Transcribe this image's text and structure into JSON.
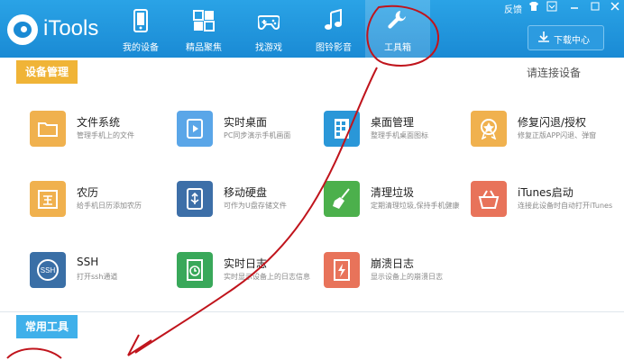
{
  "app": {
    "title": "iTools"
  },
  "nav": [
    {
      "label": "我的设备",
      "icon": "phone-icon"
    },
    {
      "label": "精品聚焦",
      "icon": "grid-apps-icon"
    },
    {
      "label": "找游戏",
      "icon": "gamepad-icon"
    },
    {
      "label": "图铃影音",
      "icon": "music-note-icon"
    },
    {
      "label": "工具箱",
      "icon": "wrench-icon",
      "active": true
    }
  ],
  "window_controls": {
    "feedback": "反馈"
  },
  "download_center": "下载中心",
  "sections": {
    "device_mgmt": "设备管理",
    "common_tools": "常用工具",
    "connect_prompt": "请连接设备"
  },
  "tools": [
    {
      "name": "文件系统",
      "desc": "管理手机上的文件",
      "icon": "folder-icon",
      "color": "#f0b14e"
    },
    {
      "name": "实时桌面",
      "desc": "PC同步演示手机画面",
      "icon": "play-screen-icon",
      "color": "#5aa6e8"
    },
    {
      "name": "桌面管理",
      "desc": "整理手机桌面图标",
      "icon": "desktop-grid-icon",
      "color": "#2a97d8"
    },
    {
      "name": "修复闪退/授权",
      "desc": "修复正版APP闪退、弹窗",
      "icon": "badge-icon",
      "color": "#f0b14e"
    },
    {
      "name": "农历",
      "desc": "给手机日历添加农历",
      "icon": "calendar-icon",
      "color": "#f0b14e"
    },
    {
      "name": "移动硬盘",
      "desc": "可作为U盘存储文件",
      "icon": "usb-drive-icon",
      "color": "#3d6fa8"
    },
    {
      "name": "清理垃圾",
      "desc": "定期清理垃圾,保持手机健康",
      "icon": "broom-icon",
      "color": "#4cb04c"
    },
    {
      "name": "iTunes启动",
      "desc": "连接此设备时自动打开iTunes",
      "icon": "basket-icon",
      "color": "#e8735a"
    },
    {
      "name": "SSH",
      "desc": "打开ssh通道",
      "icon": "ssh-icon",
      "color": "#3a6fa6"
    },
    {
      "name": "实时日志",
      "desc": "实时显示设备上的日志信息",
      "icon": "clock-doc-icon",
      "color": "#39a85a"
    },
    {
      "name": "崩溃日志",
      "desc": "显示设备上的崩溃日志",
      "icon": "crash-doc-icon",
      "color": "#e8735a"
    }
  ],
  "colors": {
    "topbar": "#1a8ad4",
    "annotation": "#c0141c"
  }
}
